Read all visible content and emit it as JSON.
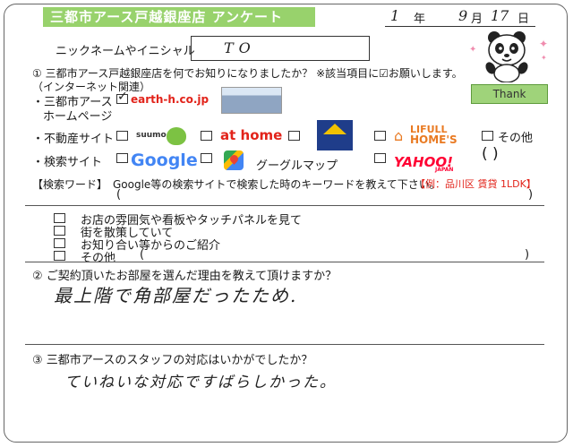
{
  "header": {
    "title": "三都市アース戸越銀座店 アンケート",
    "date_year": "1",
    "date_year_unit": "年",
    "date_month": "9",
    "date_month_unit": "月",
    "date_day": "17",
    "date_day_unit": "日"
  },
  "nickname": {
    "label": "ニックネームやイニシャル",
    "value": "TO"
  },
  "q1": {
    "question": "① 三都市アース戸越銀座店を何でお知りになりましたか？ ※該当項目に☑お願いします。",
    "sub_label": "（インターネット関連）",
    "homepage_label_1": "・三都市アース",
    "homepage_label_2": "ホームページ",
    "homepage_checked": true,
    "homepage_url": "earth-h.co.jp",
    "realestate_label": "・不動産サイト",
    "suumo": "suumo",
    "athome": "at home",
    "lifull_1": "LIFULL",
    "lifull_2": "HOME'S",
    "other_label": "その他",
    "other_paren": "(            )",
    "search_label": "・検索サイト",
    "google": "Google",
    "google_maps": "グーグルマップ",
    "yahoo": "YAHOO!",
    "yahoo_sub": "JAPAN",
    "keyword_label": "【検索ワード】",
    "keyword_instruction": "Google等の検索サイトで検索した時のキーワードを教えて下さい。",
    "keyword_example": "【例：品川区 賃貸 1LDK】",
    "keyword_paren_open": "(",
    "keyword_paren_close": ")",
    "offline_options": [
      "お店の雰囲気や看板やタッチパネルを見て",
      "街を散策していて",
      "お知り合い等からのご紹介",
      "その他"
    ],
    "offline_other_paren_open": "(",
    "offline_other_paren_close": ")"
  },
  "mascot": {
    "badge": "Thank"
  },
  "q2": {
    "question": "② ご契約頂いたお部屋を選んだ理由を教えて頂けますか？",
    "answer": "最上階で角部屋だったため."
  },
  "q3": {
    "question": "③ 三都市アースのスタッフの対応はいかがでしたか？",
    "answer": "ていねいな対応ですばらしかった。"
  },
  "colors": {
    "title_bg": "#98d26c",
    "accent_red": "#e2231a"
  }
}
